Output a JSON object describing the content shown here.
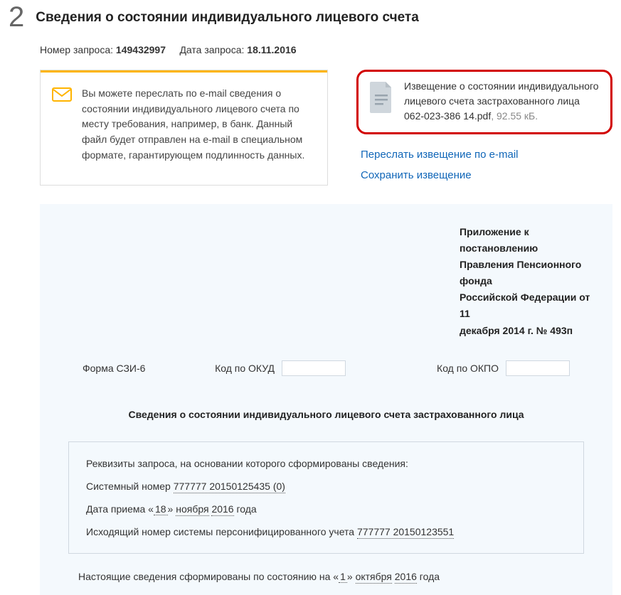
{
  "step": {
    "number": "2",
    "title": "Сведения о состоянии индивидуального лицевого счета"
  },
  "meta": {
    "request_number_label": "Номер запроса:",
    "request_number": "149432997",
    "request_date_label": "Дата запроса:",
    "request_date": "18.11.2016"
  },
  "email_hint": "Вы можете переслать по e-mail сведения о состоянии индивидуального лицевого счета по месту требования, например, в банк. Данный файл будет отправлен на e-mail в специальном формате, гарантирующем подлинность данных.",
  "file": {
    "name_prefix": "Извещение о состоянии индивидуального лицевого счета застрахованного лица 062-023-386 14.pdf",
    "size": ", 92.55 кБ."
  },
  "actions": {
    "forward": "Переслать извещение по e-mail",
    "save": "Сохранить извещение"
  },
  "appendix": {
    "l1": "Приложение к постановлению",
    "l2": "Правления Пенсионного фонда",
    "l3": "Российской Федерации от 11",
    "l4": "декабря 2014 г. № 493п"
  },
  "form": {
    "form_label": "Форма СЗИ-6",
    "okud_label": "Код по ОКУД",
    "okpo_label": "Код по ОКПО"
  },
  "doc_title": "Сведения о состоянии индивидуального лицевого счета застрахованного лица",
  "req": {
    "intro": "Реквизиты запроса, на основании которого сформированы сведения:",
    "sysnum_label": "Системный номер ",
    "sysnum": "777777 20150125435 (0)",
    "recv_pre": "Дата приема «",
    "recv_day": "18",
    "recv_mid1": "»  ",
    "recv_month": "ноября",
    "recv_mid2": "  ",
    "recv_year": "2016",
    "recv_post": "  года",
    "outnum_label": "Исходящий номер системы персонифицированного учета ",
    "outnum": "777777 20150123551"
  },
  "asof": {
    "pre": "Настоящие сведения сформированы по состоянию на   «",
    "day": "1",
    "mid1": "»  ",
    "month": "октября",
    "mid2": "  ",
    "year": "2016",
    "post": "  года"
  }
}
